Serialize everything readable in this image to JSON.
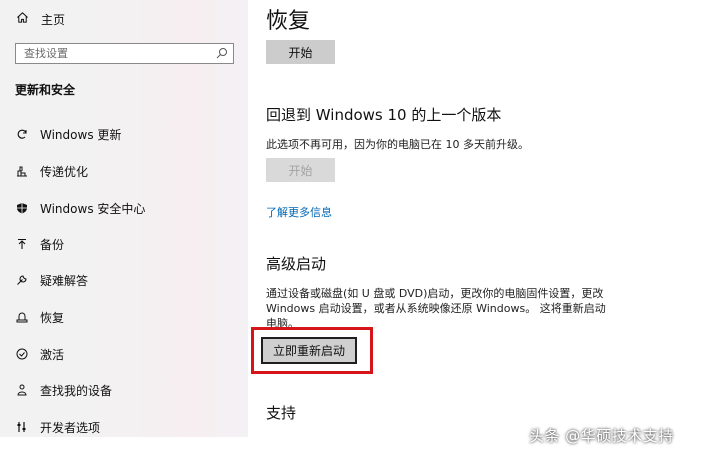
{
  "sidebar": {
    "home_label": "主页",
    "search_placeholder": "查找设置",
    "section_title": "更新和安全",
    "items": [
      {
        "label": "Windows 更新",
        "icon": "refresh-icon"
      },
      {
        "label": "传递优化",
        "icon": "delivery-optimization-icon"
      },
      {
        "label": "Windows 安全中心",
        "icon": "shield-icon"
      },
      {
        "label": "备份",
        "icon": "backup-arrow-icon"
      },
      {
        "label": "疑难解答",
        "icon": "wrench-icon"
      },
      {
        "label": "恢复",
        "icon": "recovery-icon"
      },
      {
        "label": "激活",
        "icon": "check-circle-icon"
      },
      {
        "label": "查找我的设备",
        "icon": "person-location-icon"
      },
      {
        "label": "开发者选项",
        "icon": "developer-sliders-icon"
      }
    ]
  },
  "main": {
    "title": "恢复",
    "reset_start_label": "开始",
    "rollback": {
      "heading": "回退到 Windows 10 的上一个版本",
      "description": "此选项不再可用，因为你的电脑已在 10 多天前升级。",
      "start_label": "开始",
      "start_enabled": false
    },
    "learn_more": "了解更多信息",
    "advanced": {
      "heading": "高级启动",
      "description": "通过设备或磁盘(如 U 盘或 DVD)启动，更改你的电脑固件设置，更改 Windows 启动设置，或者从系统映像还原 Windows。 这将重新启动电脑。",
      "restart_label": "立即重新启动",
      "highlight_color": "#d8141b"
    },
    "support_heading": "支持"
  },
  "watermark": "头条 @华硕技术支持"
}
